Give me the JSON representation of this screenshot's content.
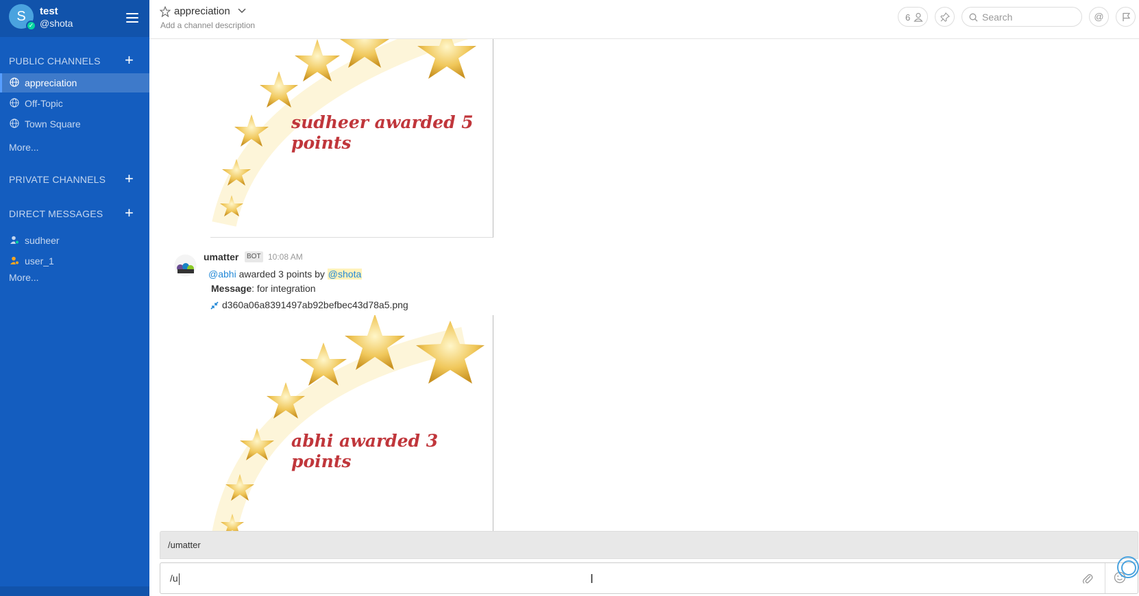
{
  "team": {
    "name": "test",
    "username": "@shota",
    "avatar_letter": "S"
  },
  "sidebar": {
    "public_title": "PUBLIC CHANNELS",
    "public_channels": [
      {
        "label": "appreciation",
        "active": true
      },
      {
        "label": "Off-Topic",
        "active": false
      },
      {
        "label": "Town Square",
        "active": false
      }
    ],
    "public_more": "More...",
    "private_title": "PRIVATE CHANNELS",
    "dm_title": "DIRECT MESSAGES",
    "dms": [
      {
        "label": "sudheer"
      },
      {
        "label": "user_1"
      }
    ],
    "dm_more": "More..."
  },
  "header": {
    "channel_name": "appreciation",
    "description": "Add a channel description",
    "member_count": "6",
    "search_placeholder": "Search",
    "at_label": "@"
  },
  "posts": {
    "first_award_line1": "sudheer awarded 5",
    "first_award_line2": "points",
    "author": "umatter",
    "bot_tag": "BOT",
    "time": "10:08 AM",
    "mention_from": "@abhi",
    "awarded_text": " awarded 3 points by ",
    "mention_to": "@shota",
    "message_label": "Message",
    "message_text": ": for integration",
    "file_name": "d360a06a8391497ab92befbec43d78a5.png",
    "second_award_line1": "abhi awarded 3",
    "second_award_line2": "points"
  },
  "composer": {
    "autocomplete_item": "/umatter",
    "input_value": "/u"
  },
  "colors": {
    "sidebar_bg": "#145dbf",
    "award_text": "#c0363b",
    "mention": "#2389d7",
    "star": "#e5b53a"
  }
}
